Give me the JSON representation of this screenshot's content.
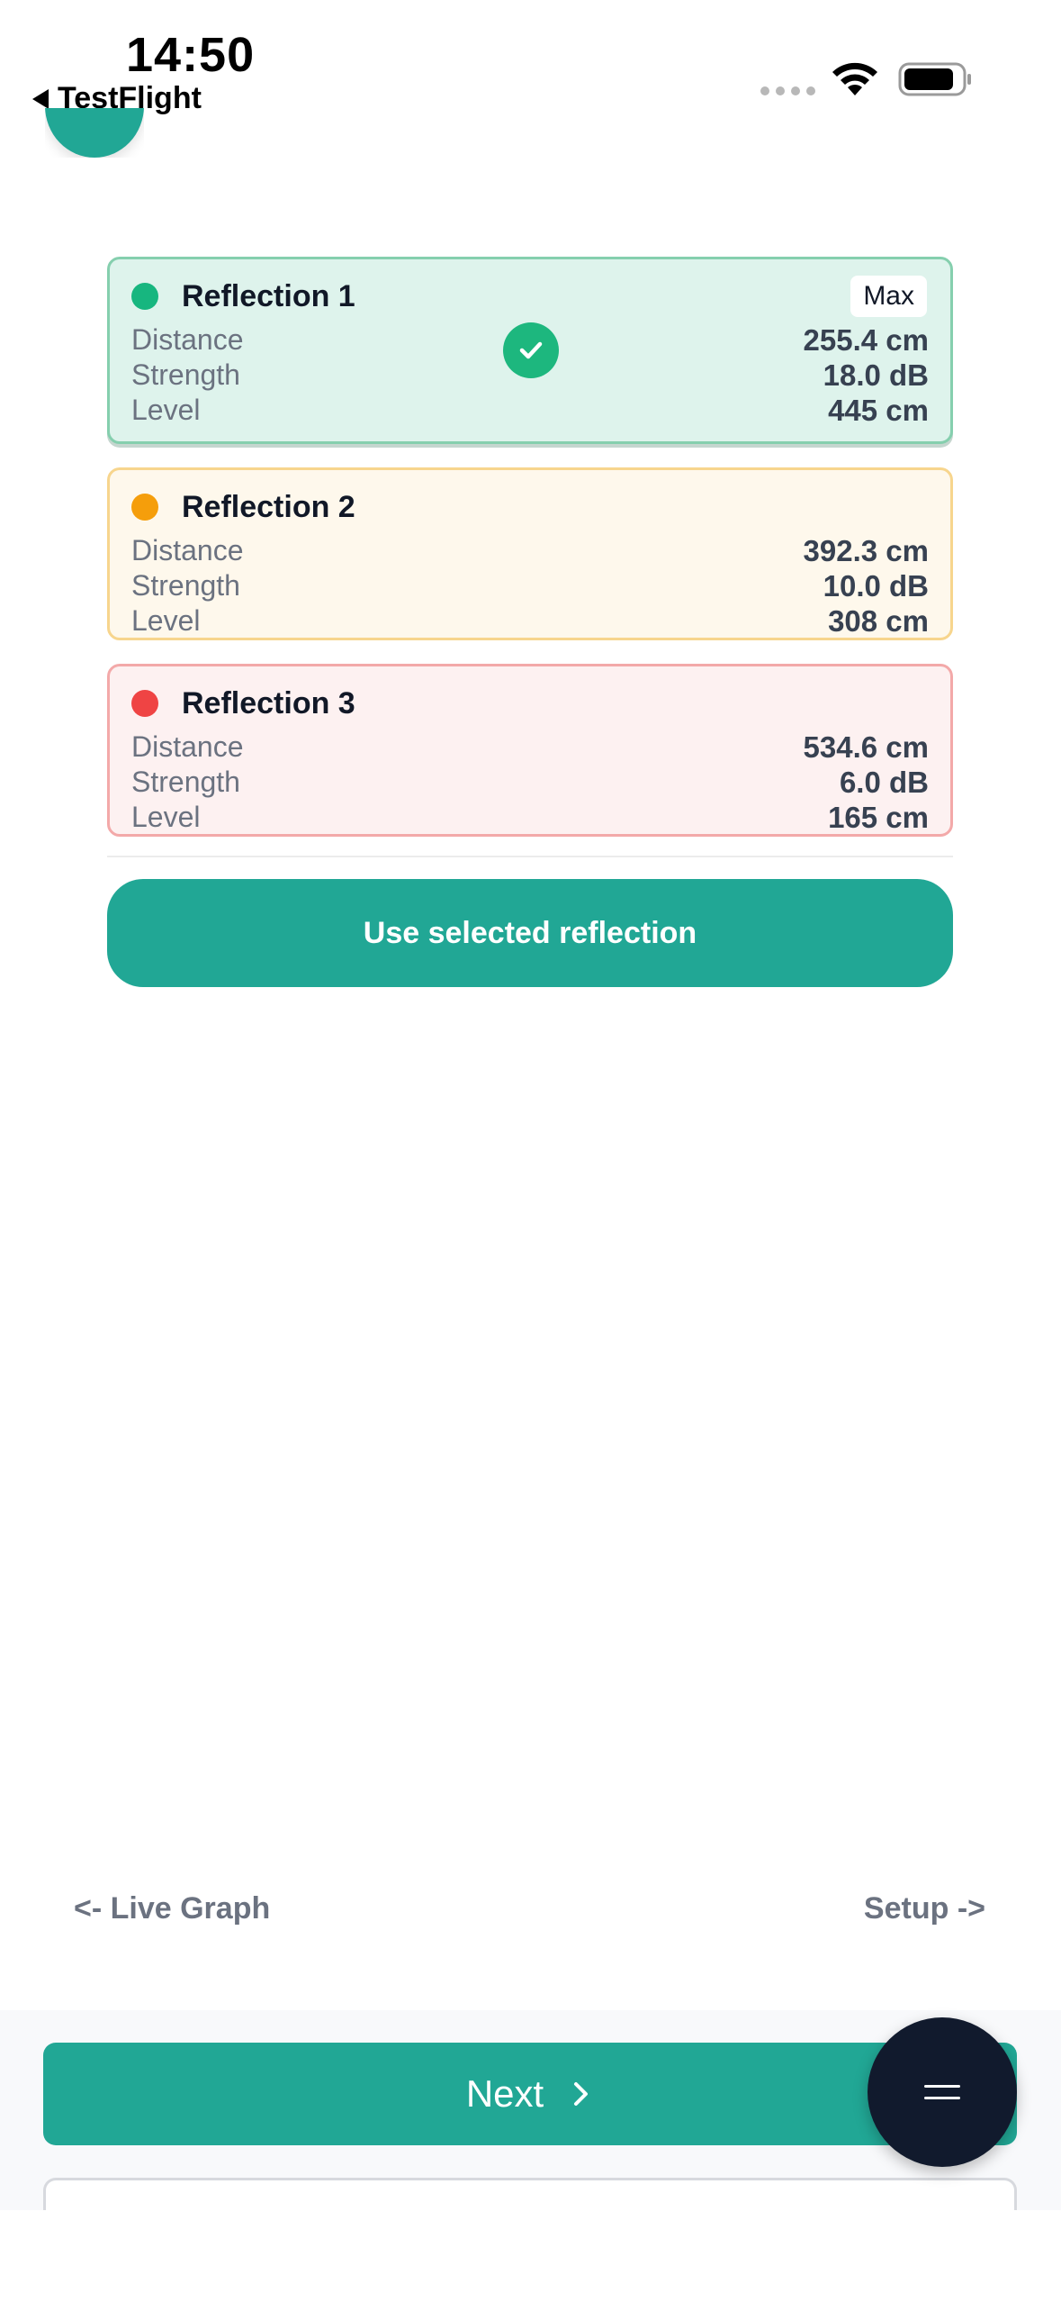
{
  "status_bar": {
    "time": "14:50",
    "back_app": "TestFlight"
  },
  "cards": [
    {
      "title": "Reflection 1",
      "badge": "Max",
      "selected": true,
      "dot_color": "#17b67f",
      "rows": [
        {
          "label": "Distance",
          "value": "255.4 cm"
        },
        {
          "label": "Strength",
          "value": "18.0 dB"
        },
        {
          "label": "Level",
          "value": "445 cm"
        }
      ]
    },
    {
      "title": "Reflection 2",
      "dot_color": "#f59e0b",
      "rows": [
        {
          "label": "Distance",
          "value": "392.3 cm"
        },
        {
          "label": "Strength",
          "value": "10.0 dB"
        },
        {
          "label": "Level",
          "value": "308 cm"
        }
      ]
    },
    {
      "title": "Reflection 3",
      "dot_color": "#ef4444",
      "rows": [
        {
          "label": "Distance",
          "value": "534.6 cm"
        },
        {
          "label": "Strength",
          "value": "6.0 dB"
        },
        {
          "label": "Level",
          "value": "165 cm"
        }
      ]
    }
  ],
  "actions": {
    "use_selected": "Use selected reflection"
  },
  "nav": {
    "prev": "<- Live Graph",
    "next": "Setup ->"
  },
  "footer": {
    "next_button": "Next"
  },
  "colors": {
    "accent": "#21a795",
    "fab": "#111a2d"
  }
}
